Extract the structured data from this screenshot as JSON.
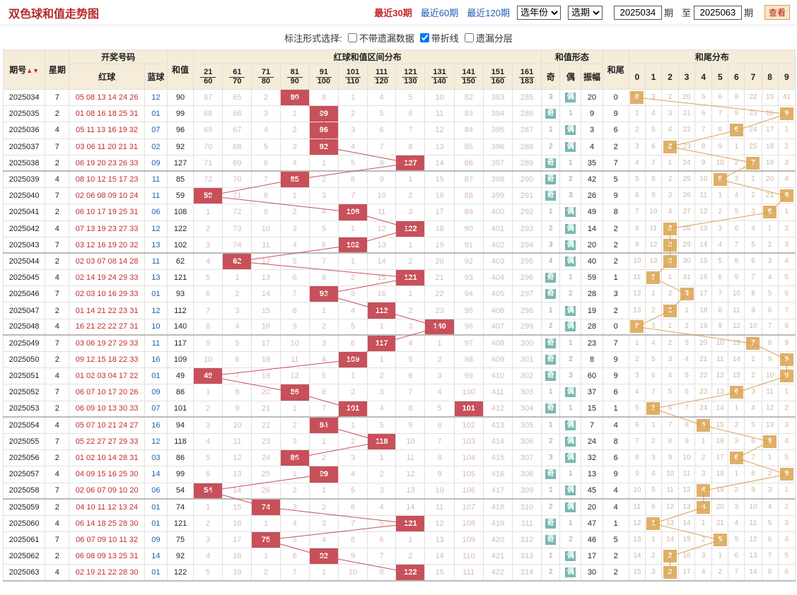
{
  "title": "双色球和值走势图",
  "controls": {
    "periods": [
      "最近30期",
      "最近60期",
      "最近120期"
    ],
    "year_select": "选年份",
    "period_select": "选期",
    "from": "2025034",
    "from_label": "期",
    "to_label": "至",
    "to": "2025063",
    "to_suffix": "期",
    "view": "查看"
  },
  "options": {
    "label": "标注形式选择:",
    "items": [
      {
        "text": "不带遗漏数据",
        "checked": false
      },
      {
        "text": "带折线",
        "checked": true
      },
      {
        "text": "遗漏分层",
        "checked": false
      }
    ]
  },
  "headers": {
    "period": "期号",
    "week": "星期",
    "draw": "开奖号码",
    "red": "红球",
    "blue": "蓝球",
    "sum": "和值",
    "dist": "红球和值区间分布",
    "shape": "和值形态",
    "odd": "奇",
    "even": "偶",
    "amp": "振幅",
    "tail": "和尾",
    "taildist": "和尾分布",
    "ranges": [
      [
        "21",
        "60"
      ],
      [
        "61",
        "70"
      ],
      [
        "71",
        "80"
      ],
      [
        "81",
        "90"
      ],
      [
        "91",
        "100"
      ],
      [
        "101",
        "110"
      ],
      [
        "111",
        "120"
      ],
      [
        "121",
        "130"
      ],
      [
        "131",
        "140"
      ],
      [
        "141",
        "150"
      ],
      [
        "151",
        "160"
      ],
      [
        "161",
        "183"
      ]
    ],
    "digits": [
      "0",
      "1",
      "2",
      "3",
      "4",
      "5",
      "6",
      "7",
      "8",
      "9"
    ]
  },
  "colors": {
    "hit": "#c8505a",
    "odd_even": "#7bb7b0",
    "tail": "#dfb067"
  },
  "rows": [
    {
      "p": "2025034",
      "w": "7",
      "r": "05 08 13 14 24 26",
      "b": "12",
      "s": "90",
      "d": [
        "67",
        "65",
        "2",
        "90",
        "8",
        "1",
        "4",
        "5",
        "10",
        "82",
        "383",
        "285"
      ],
      "oe": [
        "3",
        "偶"
      ],
      "amp": "20",
      "t": "0",
      "td": [
        "0",
        "3",
        "2",
        "20",
        "5",
        "6",
        "8",
        "22",
        "15",
        "41"
      ]
    },
    {
      "p": "2025035",
      "w": "2",
      "r": "01 08 16 18 25 31",
      "b": "01",
      "s": "99",
      "d": [
        "68",
        "66",
        "3",
        "1",
        "99",
        "2",
        "5",
        "6",
        "11",
        "83",
        "394",
        "286"
      ],
      "oe": [
        "奇",
        "1"
      ],
      "amp": "9",
      "t": "9",
      "td": [
        "1",
        "4",
        "3",
        "21",
        "6",
        "7",
        "9",
        "23",
        "16",
        "9"
      ]
    },
    {
      "p": "2025036",
      "w": "4",
      "r": "05 11 13 16 19 32",
      "b": "07",
      "s": "96",
      "d": [
        "69",
        "67",
        "4",
        "2",
        "96",
        "3",
        "6",
        "7",
        "12",
        "84",
        "395",
        "287"
      ],
      "oe": [
        "1",
        "偶"
      ],
      "amp": "3",
      "t": "6",
      "td": [
        "2",
        "5",
        "4",
        "22",
        "7",
        "8",
        "6",
        "24",
        "17",
        "1"
      ]
    },
    {
      "p": "2025037",
      "w": "7",
      "r": "03 06 11 20 21 31",
      "b": "02",
      "s": "92",
      "d": [
        "70",
        "68",
        "5",
        "3",
        "92",
        "4",
        "7",
        "8",
        "13",
        "85",
        "396",
        "288"
      ],
      "oe": [
        "2",
        "偶"
      ],
      "amp": "4",
      "t": "2",
      "td": [
        "3",
        "6",
        "2",
        "23",
        "8",
        "9",
        "1",
        "25",
        "18",
        "2"
      ]
    },
    {
      "p": "2025038",
      "w": "2",
      "r": "06 19 20 23 26 33",
      "b": "09",
      "s": "127",
      "d": [
        "71",
        "69",
        "6",
        "4",
        "1",
        "5",
        "8",
        "127",
        "14",
        "86",
        "397",
        "289"
      ],
      "oe": [
        "奇",
        "1"
      ],
      "amp": "35",
      "t": "7",
      "td": [
        "4",
        "7",
        "1",
        "24",
        "9",
        "10",
        "2",
        "7",
        "19",
        "3"
      ]
    },
    {
      "p": "2025039",
      "w": "4",
      "r": "08 10 12 15 17 23",
      "b": "11",
      "s": "85",
      "d": [
        "72",
        "70",
        "7",
        "85",
        "2",
        "6",
        "9",
        "1",
        "15",
        "87",
        "398",
        "290"
      ],
      "oe": [
        "奇",
        "2"
      ],
      "amp": "42",
      "t": "5",
      "td": [
        "5",
        "8",
        "2",
        "25",
        "10",
        "5",
        "3",
        "1",
        "20",
        "4"
      ]
    },
    {
      "p": "2025040",
      "w": "7",
      "r": "02 06 08 09 10 24",
      "b": "11",
      "s": "59",
      "d": [
        "59",
        "71",
        "8",
        "1",
        "3",
        "7",
        "10",
        "2",
        "16",
        "88",
        "399",
        "291"
      ],
      "oe": [
        "奇",
        "3"
      ],
      "amp": "26",
      "t": "9",
      "td": [
        "6",
        "9",
        "3",
        "26",
        "11",
        "1",
        "4",
        "2",
        "21",
        "9"
      ]
    },
    {
      "p": "2025041",
      "w": "2",
      "r": "06 10 17 19 25 31",
      "b": "06",
      "s": "108",
      "d": [
        "1",
        "72",
        "9",
        "2",
        "4",
        "108",
        "11",
        "3",
        "17",
        "89",
        "400",
        "292"
      ],
      "oe": [
        "1",
        "偶"
      ],
      "amp": "49",
      "t": "8",
      "td": [
        "7",
        "10",
        "4",
        "27",
        "12",
        "2",
        "5",
        "3",
        "8",
        "1"
      ]
    },
    {
      "p": "2025042",
      "w": "4",
      "r": "07 13 19 23 27 33",
      "b": "12",
      "s": "122",
      "d": [
        "2",
        "73",
        "10",
        "3",
        "5",
        "1",
        "12",
        "122",
        "18",
        "90",
        "401",
        "293"
      ],
      "oe": [
        "2",
        "偶"
      ],
      "amp": "14",
      "t": "2",
      "td": [
        "8",
        "11",
        "2",
        "28",
        "13",
        "3",
        "6",
        "4",
        "1",
        "2"
      ]
    },
    {
      "p": "2025043",
      "w": "7",
      "r": "03 12 16 19 20 32",
      "b": "13",
      "s": "102",
      "d": [
        "3",
        "74",
        "11",
        "4",
        "6",
        "102",
        "13",
        "1",
        "19",
        "91",
        "402",
        "294"
      ],
      "oe": [
        "3",
        "偶"
      ],
      "amp": "20",
      "t": "2",
      "td": [
        "9",
        "12",
        "2",
        "29",
        "14",
        "4",
        "7",
        "5",
        "2",
        "3"
      ]
    },
    {
      "p": "2025044",
      "w": "2",
      "r": "02 03 07 08 14 28",
      "b": "11",
      "s": "62",
      "d": [
        "4",
        "62",
        "12",
        "5",
        "7",
        "1",
        "14",
        "2",
        "20",
        "92",
        "403",
        "295"
      ],
      "oe": [
        "4",
        "偶"
      ],
      "amp": "40",
      "t": "2",
      "td": [
        "10",
        "13",
        "2",
        "30",
        "15",
        "5",
        "8",
        "6",
        "3",
        "4"
      ]
    },
    {
      "p": "2025045",
      "w": "4",
      "r": "02 14 19 24 29 33",
      "b": "13",
      "s": "121",
      "d": [
        "5",
        "1",
        "13",
        "6",
        "8",
        "2",
        "15",
        "121",
        "21",
        "93",
        "404",
        "296"
      ],
      "oe": [
        "奇",
        "1"
      ],
      "amp": "59",
      "t": "1",
      "td": [
        "11",
        "1",
        "1",
        "31",
        "16",
        "6",
        "9",
        "7",
        "4",
        "5"
      ]
    },
    {
      "p": "2025046",
      "w": "7",
      "r": "02 03 10 16 29 33",
      "b": "01",
      "s": "93",
      "d": [
        "6",
        "2",
        "14",
        "7",
        "93",
        "3",
        "16",
        "1",
        "22",
        "94",
        "405",
        "297"
      ],
      "oe": [
        "奇",
        "2"
      ],
      "amp": "28",
      "t": "3",
      "td": [
        "12",
        "1",
        "2",
        "3",
        "17",
        "7",
        "10",
        "8",
        "5",
        "6"
      ]
    },
    {
      "p": "2025047",
      "w": "2",
      "r": "01 14 21 22 23 31",
      "b": "12",
      "s": "112",
      "d": [
        "7",
        "3",
        "15",
        "8",
        "1",
        "4",
        "112",
        "2",
        "23",
        "95",
        "406",
        "298"
      ],
      "oe": [
        "1",
        "偶"
      ],
      "amp": "19",
      "t": "2",
      "td": [
        "13",
        "2",
        "2",
        "1",
        "18",
        "8",
        "11",
        "9",
        "6",
        "7"
      ]
    },
    {
      "p": "2025048",
      "w": "4",
      "r": "16 21 22 22 27 31",
      "b": "10",
      "s": "140",
      "d": [
        "8",
        "4",
        "16",
        "9",
        "2",
        "5",
        "1",
        "3",
        "140",
        "96",
        "407",
        "299"
      ],
      "oe": [
        "2",
        "偶"
      ],
      "amp": "28",
      "t": "0",
      "td": [
        "0",
        "3",
        "1",
        "2",
        "19",
        "9",
        "12",
        "10",
        "7",
        "8"
      ]
    },
    {
      "p": "2025049",
      "w": "7",
      "r": "03 06 19 27 29 33",
      "b": "11",
      "s": "117",
      "d": [
        "9",
        "5",
        "17",
        "10",
        "3",
        "6",
        "117",
        "4",
        "1",
        "97",
        "408",
        "300"
      ],
      "oe": [
        "奇",
        "1"
      ],
      "amp": "23",
      "t": "7",
      "td": [
        "1",
        "4",
        "2",
        "3",
        "20",
        "10",
        "13",
        "7",
        "8",
        "9"
      ]
    },
    {
      "p": "2025050",
      "w": "2",
      "r": "09 12 15 18 22 33",
      "b": "16",
      "s": "109",
      "d": [
        "10",
        "6",
        "18",
        "11",
        "4",
        "109",
        "1",
        "5",
        "2",
        "98",
        "409",
        "301"
      ],
      "oe": [
        "奇",
        "2"
      ],
      "amp": "8",
      "t": "9",
      "td": [
        "2",
        "5",
        "3",
        "4",
        "21",
        "11",
        "14",
        "1",
        "9",
        "9"
      ]
    },
    {
      "p": "2025051",
      "w": "4",
      "r": "01 02 03 04 17 22",
      "b": "01",
      "s": "49",
      "d": [
        "49",
        "7",
        "19",
        "12",
        "5",
        "1",
        "2",
        "6",
        "3",
        "99",
        "410",
        "302"
      ],
      "oe": [
        "奇",
        "3"
      ],
      "amp": "60",
      "t": "9",
      "td": [
        "3",
        "6",
        "4",
        "5",
        "22",
        "12",
        "15",
        "2",
        "10",
        "9"
      ]
    },
    {
      "p": "2025052",
      "w": "7",
      "r": "06 07 10 17 20 26",
      "b": "09",
      "s": "86",
      "d": [
        "1",
        "8",
        "20",
        "86",
        "6",
        "2",
        "3",
        "7",
        "4",
        "100",
        "411",
        "303"
      ],
      "oe": [
        "1",
        "偶"
      ],
      "amp": "37",
      "t": "6",
      "td": [
        "4",
        "7",
        "5",
        "6",
        "23",
        "13",
        "6",
        "3",
        "11",
        "1"
      ]
    },
    {
      "p": "2025053",
      "w": "2",
      "r": "06 09 10 13 30 33",
      "b": "07",
      "s": "101",
      "d": [
        "2",
        "9",
        "21",
        "1",
        "7",
        "101",
        "4",
        "8",
        "5",
        "101",
        "412",
        "304"
      ],
      "oe": [
        "奇",
        "1"
      ],
      "amp": "15",
      "t": "1",
      "td": [
        "5",
        "1",
        "6",
        "7",
        "24",
        "14",
        "1",
        "4",
        "12",
        "2"
      ]
    },
    {
      "p": "2025054",
      "w": "4",
      "r": "05 07 10 21 24 27",
      "b": "16",
      "s": "94",
      "d": [
        "3",
        "10",
        "22",
        "2",
        "94",
        "1",
        "5",
        "9",
        "6",
        "102",
        "413",
        "305"
      ],
      "oe": [
        "1",
        "偶"
      ],
      "amp": "7",
      "t": "4",
      "td": [
        "6",
        "1",
        "7",
        "8",
        "4",
        "15",
        "2",
        "5",
        "13",
        "3"
      ]
    },
    {
      "p": "2025055",
      "w": "7",
      "r": "05 22 27 27 29 33",
      "b": "12",
      "s": "118",
      "d": [
        "4",
        "11",
        "23",
        "3",
        "1",
        "2",
        "118",
        "10",
        "7",
        "103",
        "414",
        "306"
      ],
      "oe": [
        "2",
        "偶"
      ],
      "amp": "24",
      "t": "8",
      "td": [
        "7",
        "2",
        "8",
        "9",
        "1",
        "16",
        "3",
        "6",
        "8",
        "4"
      ]
    },
    {
      "p": "2025056",
      "w": "2",
      "r": "01 02 10 14 28 31",
      "b": "03",
      "s": "86",
      "d": [
        "5",
        "12",
        "24",
        "86",
        "2",
        "3",
        "1",
        "11",
        "8",
        "104",
        "415",
        "307"
      ],
      "oe": [
        "3",
        "偶"
      ],
      "amp": "32",
      "t": "6",
      "td": [
        "8",
        "3",
        "9",
        "10",
        "2",
        "17",
        "6",
        "7",
        "1",
        "5"
      ]
    },
    {
      "p": "2025057",
      "w": "4",
      "r": "04 09 15 16 25 30",
      "b": "14",
      "s": "99",
      "d": [
        "6",
        "13",
        "25",
        "1",
        "99",
        "4",
        "2",
        "12",
        "9",
        "105",
        "416",
        "308"
      ],
      "oe": [
        "奇",
        "1"
      ],
      "amp": "13",
      "t": "9",
      "td": [
        "9",
        "4",
        "10",
        "11",
        "3",
        "18",
        "1",
        "8",
        "2",
        "9"
      ]
    },
    {
      "p": "2025058",
      "w": "7",
      "r": "02 06 07 09 10 20",
      "b": "06",
      "s": "54",
      "d": [
        "54",
        "14",
        "26",
        "2",
        "1",
        "5",
        "3",
        "13",
        "10",
        "106",
        "417",
        "309"
      ],
      "oe": [
        "1",
        "偶"
      ],
      "amp": "45",
      "t": "4",
      "td": [
        "10",
        "5",
        "11",
        "12",
        "4",
        "19",
        "2",
        "9",
        "3",
        "1"
      ]
    },
    {
      "p": "2025059",
      "w": "2",
      "r": "04 10 11 12 13 24",
      "b": "01",
      "s": "74",
      "d": [
        "1",
        "15",
        "74",
        "3",
        "2",
        "6",
        "4",
        "14",
        "11",
        "107",
        "418",
        "310"
      ],
      "oe": [
        "2",
        "偶"
      ],
      "amp": "20",
      "t": "4",
      "td": [
        "11",
        "6",
        "12",
        "13",
        "4",
        "20",
        "3",
        "10",
        "4",
        "2"
      ]
    },
    {
      "p": "2025060",
      "w": "4",
      "r": "06 14 18 25 28 30",
      "b": "01",
      "s": "121",
      "d": [
        "2",
        "16",
        "1",
        "4",
        "3",
        "7",
        "5",
        "121",
        "12",
        "108",
        "419",
        "311"
      ],
      "oe": [
        "奇",
        "1"
      ],
      "amp": "47",
      "t": "1",
      "td": [
        "12",
        "1",
        "13",
        "14",
        "1",
        "21",
        "4",
        "11",
        "5",
        "3"
      ]
    },
    {
      "p": "2025061",
      "w": "7",
      "r": "06 07 09 10 11 32",
      "b": "09",
      "s": "75",
      "d": [
        "3",
        "17",
        "75",
        "5",
        "4",
        "8",
        "6",
        "1",
        "13",
        "109",
        "420",
        "312"
      ],
      "oe": [
        "奇",
        "2"
      ],
      "amp": "46",
      "t": "5",
      "td": [
        "13",
        "1",
        "14",
        "15",
        "2",
        "5",
        "5",
        "12",
        "6",
        "4"
      ]
    },
    {
      "p": "2025062",
      "w": "2",
      "r": "06 08 09 13 25 31",
      "b": "14",
      "s": "92",
      "d": [
        "4",
        "18",
        "1",
        "6",
        "92",
        "9",
        "7",
        "2",
        "14",
        "110",
        "421",
        "313"
      ],
      "oe": [
        "1",
        "偶"
      ],
      "amp": "17",
      "t": "2",
      "td": [
        "14",
        "2",
        "2",
        "16",
        "3",
        "1",
        "6",
        "13",
        "7",
        "5"
      ]
    },
    {
      "p": "2025063",
      "w": "4",
      "r": "02 19 21 22 28 30",
      "b": "01",
      "s": "122",
      "d": [
        "5",
        "19",
        "2",
        "7",
        "1",
        "10",
        "8",
        "122",
        "15",
        "111",
        "422",
        "314"
      ],
      "oe": [
        "2",
        "偶"
      ],
      "amp": "30",
      "t": "2",
      "td": [
        "15",
        "3",
        "2",
        "17",
        "4",
        "2",
        "7",
        "14",
        "8",
        "6"
      ]
    }
  ]
}
